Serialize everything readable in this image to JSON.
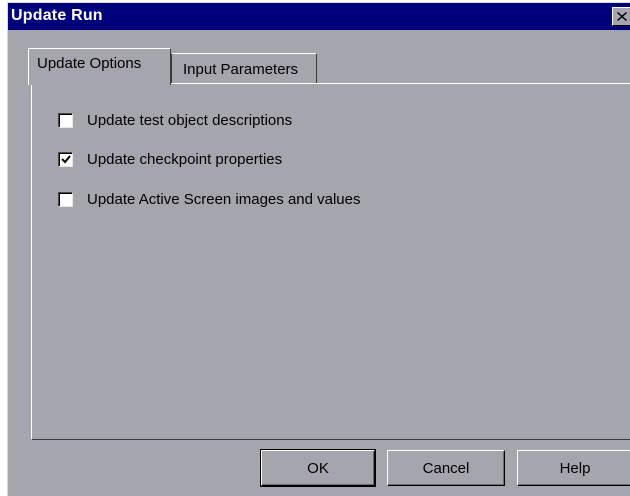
{
  "window": {
    "title": "Update Run",
    "close_icon": "close-icon"
  },
  "tabs": [
    {
      "label": "Update Options",
      "active": true
    },
    {
      "label": "Input Parameters",
      "active": false
    }
  ],
  "options": [
    {
      "label": "Update test object descriptions",
      "checked": false
    },
    {
      "label": "Update checkpoint properties",
      "checked": true
    },
    {
      "label": "Update Active Screen images and values",
      "checked": false
    }
  ],
  "buttons": {
    "ok": "OK",
    "cancel": "Cancel",
    "help": "Help"
  },
  "colors": {
    "titlebar": "#00007b",
    "face": "#a5a5ad"
  }
}
